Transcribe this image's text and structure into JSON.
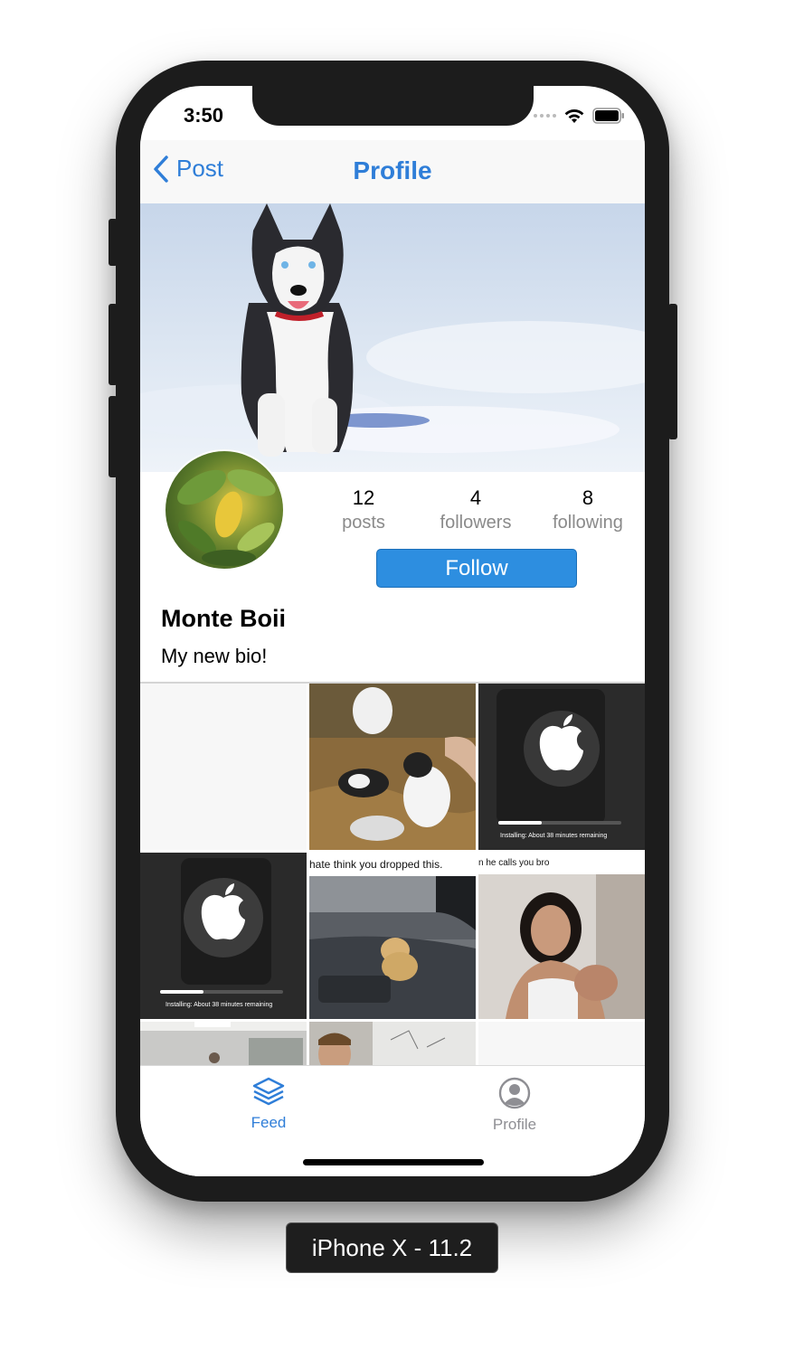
{
  "status_bar": {
    "time": "3:50"
  },
  "nav": {
    "back_label": "Post",
    "title": "Profile"
  },
  "profile": {
    "posts_count": "12",
    "posts_label": "posts",
    "followers_count": "4",
    "followers_label": "followers",
    "following_count": "8",
    "following_label": "following",
    "follow_label": "Follow",
    "name": "Monte Boii",
    "bio": "My new bio!"
  },
  "grid": {
    "meme1_caption": "hate think you dropped this.",
    "meme2_caption": "n he calls you bro",
    "install_text": "Installing: About 38 minutes remaining"
  },
  "tabs": [
    {
      "label": "Feed",
      "icon": "layers-icon"
    },
    {
      "label": "Profile",
      "icon": "person-circle-icon"
    }
  ],
  "device_label": "iPhone X - 11.2",
  "colors": {
    "accent": "#2f7ed8",
    "follow_button": "#2d8ee0",
    "inactive_tab": "#8e8e93"
  }
}
